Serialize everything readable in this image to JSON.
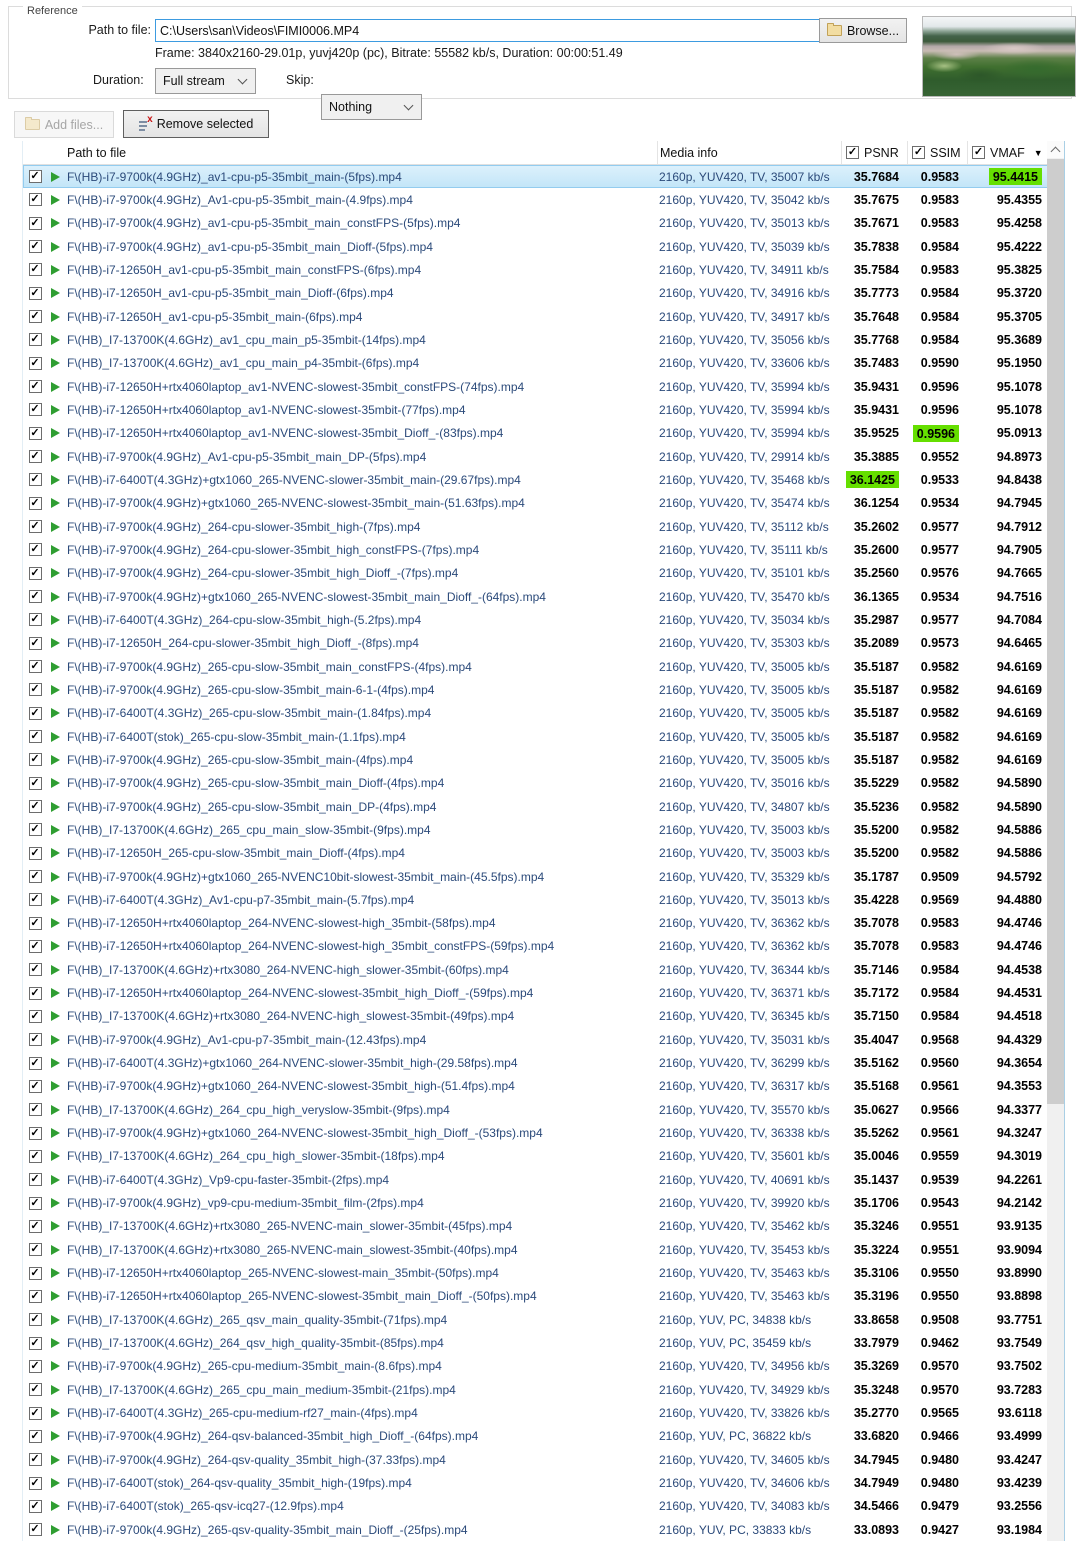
{
  "reference": {
    "group_label": "Reference",
    "path_label": "Path to file:",
    "path_value": "C:\\Users\\san\\Videos\\FIMI0006.MP4",
    "browse_label": "Browse...",
    "frame_info": "Frame: 3840x2160-29.01p, yuvj420p (pc), Bitrate: 55582 kb/s, Duration: 00:00:51.49",
    "duration_label": "Duration:",
    "duration_value": "Full stream",
    "skip_label": "Skip:",
    "skip_value": "Nothing"
  },
  "toolbar": {
    "add_files_label": "Add files...",
    "remove_selected_label": "Remove selected"
  },
  "table": {
    "columns": {
      "path": "Path to file",
      "media": "Media info",
      "psnr": "PSNR",
      "ssim": "SSIM",
      "vmaf": "VMAF"
    },
    "column_checkboxes": {
      "psnr": true,
      "ssim": true,
      "vmaf": true
    },
    "sort_column": "VMAF",
    "sort_direction": "desc",
    "rows": [
      {
        "file": "F\\(HB)-i7-9700k(4.9GHz)_av1-cpu-p5-35mbit_main-(5fps).mp4",
        "media": "2160p, YUV420, TV, 35007 kb/s",
        "psnr": "35.7684",
        "ssim": "0.9583",
        "vmaf": "95.4415",
        "hl": "vmaf",
        "selected": true
      },
      {
        "file": "F\\(HB)-i7-9700k(4.9GHz)_Av1-cpu-p5-35mbit_main-(4.9fps).mp4",
        "media": "2160p, YUV420, TV, 35042 kb/s",
        "psnr": "35.7675",
        "ssim": "0.9583",
        "vmaf": "95.4355"
      },
      {
        "file": "F\\(HB)-i7-9700k(4.9GHz)_av1-cpu-p5-35mbit_main_constFPS-(5fps).mp4",
        "media": "2160p, YUV420, TV, 35013 kb/s",
        "psnr": "35.7671",
        "ssim": "0.9583",
        "vmaf": "95.4258"
      },
      {
        "file": "F\\(HB)-i7-9700k(4.9GHz)_av1-cpu-p5-35mbit_main_Dioff-(5fps).mp4",
        "media": "2160p, YUV420, TV, 35039 kb/s",
        "psnr": "35.7838",
        "ssim": "0.9584",
        "vmaf": "95.4222"
      },
      {
        "file": "F\\(HB)-i7-12650H_av1-cpu-p5-35mbit_main_constFPS-(6fps).mp4",
        "media": "2160p, YUV420, TV, 34911 kb/s",
        "psnr": "35.7584",
        "ssim": "0.9583",
        "vmaf": "95.3825"
      },
      {
        "file": "F\\(HB)-i7-12650H_av1-cpu-p5-35mbit_main_Dioff-(6fps).mp4",
        "media": "2160p, YUV420, TV, 34916 kb/s",
        "psnr": "35.7773",
        "ssim": "0.9584",
        "vmaf": "95.3720"
      },
      {
        "file": "F\\(HB)-i7-12650H_av1-cpu-p5-35mbit_main-(6fps).mp4",
        "media": "2160p, YUV420, TV, 34917 kb/s",
        "psnr": "35.7648",
        "ssim": "0.9584",
        "vmaf": "95.3705"
      },
      {
        "file": "F\\(HB)_I7-13700K(4.6GHz)_av1_cpu_main_p5-35mbit-(14fps).mp4",
        "media": "2160p, YUV420, TV, 35056 kb/s",
        "psnr": "35.7768",
        "ssim": "0.9584",
        "vmaf": "95.3689"
      },
      {
        "file": "F\\(HB)_I7-13700K(4.6GHz)_av1_cpu_main_p4-35mbit-(6fps).mp4",
        "media": "2160p, YUV420, TV, 33606 kb/s",
        "psnr": "35.7483",
        "ssim": "0.9590",
        "vmaf": "95.1950"
      },
      {
        "file": "F\\(HB)-i7-12650H+rtx4060laptop_av1-NVENC-slowest-35mbit_constFPS-(74fps).mp4",
        "media": "2160p, YUV420, TV, 35994 kb/s",
        "psnr": "35.9431",
        "ssim": "0.9596",
        "vmaf": "95.1078"
      },
      {
        "file": "F\\(HB)-i7-12650H+rtx4060laptop_av1-NVENC-slowest-35mbit-(77fps).mp4",
        "media": "2160p, YUV420, TV, 35994 kb/s",
        "psnr": "35.9431",
        "ssim": "0.9596",
        "vmaf": "95.1078"
      },
      {
        "file": "F\\(HB)-i7-12650H+rtx4060laptop_av1-NVENC-slowest-35mbit_Dioff_-(83fps).mp4",
        "media": "2160p, YUV420, TV, 35994 kb/s",
        "psnr": "35.9525",
        "ssim": "0.9596",
        "vmaf": "95.0913",
        "hl": "ssim"
      },
      {
        "file": "F\\(HB)-i7-9700k(4.9GHz)_Av1-cpu-p5-35mbit_main_DP-(5fps).mp4",
        "media": "2160p, YUV420, TV, 29914 kb/s",
        "psnr": "35.3885",
        "ssim": "0.9552",
        "vmaf": "94.8973"
      },
      {
        "file": "F\\(HB)-i7-6400T(4.3GHz)+gtx1060_265-NVENC-slower-35mbit_main-(29.67fps).mp4",
        "media": "2160p, YUV420, TV, 35468 kb/s",
        "psnr": "36.1425",
        "ssim": "0.9533",
        "vmaf": "94.8438",
        "hl": "psnr"
      },
      {
        "file": "F\\(HB)-i7-9700k(4.9GHz)+gtx1060_265-NVENC-slowest-35mbit_main-(51.63fps).mp4",
        "media": "2160p, YUV420, TV, 35474 kb/s",
        "psnr": "36.1254",
        "ssim": "0.9534",
        "vmaf": "94.7945"
      },
      {
        "file": "F\\(HB)-i7-9700k(4.9GHz)_264-cpu-slower-35mbit_high-(7fps).mp4",
        "media": "2160p, YUV420, TV, 35112 kb/s",
        "psnr": "35.2602",
        "ssim": "0.9577",
        "vmaf": "94.7912"
      },
      {
        "file": "F\\(HB)-i7-9700k(4.9GHz)_264-cpu-slower-35mbit_high_constFPS-(7fps).mp4",
        "media": "2160p, YUV420, TV, 35111 kb/s",
        "psnr": "35.2600",
        "ssim": "0.9577",
        "vmaf": "94.7905"
      },
      {
        "file": "F\\(HB)-i7-9700k(4.9GHz)_264-cpu-slower-35mbit_high_Dioff_-(7fps).mp4",
        "media": "2160p, YUV420, TV, 35101 kb/s",
        "psnr": "35.2560",
        "ssim": "0.9576",
        "vmaf": "94.7665"
      },
      {
        "file": "F\\(HB)-i7-9700k(4.9GHz)+gtx1060_265-NVENC-slowest-35mbit_main_Dioff_-(64fps).mp4",
        "media": "2160p, YUV420, TV, 35470 kb/s",
        "psnr": "36.1365",
        "ssim": "0.9534",
        "vmaf": "94.7516"
      },
      {
        "file": "F\\(HB)-i7-6400T(4.3GHz)_264-cpu-slow-35mbit_high-(5.2fps).mp4",
        "media": "2160p, YUV420, TV, 35034 kb/s",
        "psnr": "35.2987",
        "ssim": "0.9577",
        "vmaf": "94.7084"
      },
      {
        "file": "F\\(HB)-i7-12650H_264-cpu-slower-35mbit_high_Dioff_-(8fps).mp4",
        "media": "2160p, YUV420, TV, 35303 kb/s",
        "psnr": "35.2089",
        "ssim": "0.9573",
        "vmaf": "94.6465"
      },
      {
        "file": "F\\(HB)-i7-9700k(4.9GHz)_265-cpu-slow-35mbit_main_constFPS-(4fps).mp4",
        "media": "2160p, YUV420, TV, 35005 kb/s",
        "psnr": "35.5187",
        "ssim": "0.9582",
        "vmaf": "94.6169"
      },
      {
        "file": "F\\(HB)-i7-9700k(4.9GHz)_265-cpu-slow-35mbit_main-6-1-(4fps).mp4",
        "media": "2160p, YUV420, TV, 35005 kb/s",
        "psnr": "35.5187",
        "ssim": "0.9582",
        "vmaf": "94.6169"
      },
      {
        "file": "F\\(HB)-i7-6400T(4.3GHz)_265-cpu-slow-35mbit_main-(1.84fps).mp4",
        "media": "2160p, YUV420, TV, 35005 kb/s",
        "psnr": "35.5187",
        "ssim": "0.9582",
        "vmaf": "94.6169"
      },
      {
        "file": "F\\(HB)-i7-6400T(stok)_265-cpu-slow-35mbit_main-(1.1fps).mp4",
        "media": "2160p, YUV420, TV, 35005 kb/s",
        "psnr": "35.5187",
        "ssim": "0.9582",
        "vmaf": "94.6169"
      },
      {
        "file": "F\\(HB)-i7-9700k(4.9GHz)_265-cpu-slow-35mbit_main-(4fps).mp4",
        "media": "2160p, YUV420, TV, 35005 kb/s",
        "psnr": "35.5187",
        "ssim": "0.9582",
        "vmaf": "94.6169"
      },
      {
        "file": "F\\(HB)-i7-9700k(4.9GHz)_265-cpu-slow-35mbit_main_Dioff-(4fps).mp4",
        "media": "2160p, YUV420, TV, 35016 kb/s",
        "psnr": "35.5229",
        "ssim": "0.9582",
        "vmaf": "94.5890"
      },
      {
        "file": "F\\(HB)-i7-9700k(4.9GHz)_265-cpu-slow-35mbit_main_DP-(4fps).mp4",
        "media": "2160p, YUV420, TV, 34807 kb/s",
        "psnr": "35.5236",
        "ssim": "0.9582",
        "vmaf": "94.5890"
      },
      {
        "file": "F\\(HB)_I7-13700K(4.6GHz)_265_cpu_main_slow-35mbit-(9fps).mp4",
        "media": "2160p, YUV420, TV, 35003 kb/s",
        "psnr": "35.5200",
        "ssim": "0.9582",
        "vmaf": "94.5886"
      },
      {
        "file": "F\\(HB)-i7-12650H_265-cpu-slow-35mbit_main_Dioff-(4fps).mp4",
        "media": "2160p, YUV420, TV, 35003 kb/s",
        "psnr": "35.5200",
        "ssim": "0.9582",
        "vmaf": "94.5886"
      },
      {
        "file": "F\\(HB)-i7-9700k(4.9GHz)+gtx1060_265-NVENC10bit-slowest-35mbit_main-(45.5fps).mp4",
        "media": "2160p, YUV420, TV, 35329 kb/s",
        "psnr": "35.1787",
        "ssim": "0.9509",
        "vmaf": "94.5792"
      },
      {
        "file": "F\\(HB)-i7-6400T(4.3GHz)_Av1-cpu-p7-35mbit_main-(5.7fps).mp4",
        "media": "2160p, YUV420, TV, 35013 kb/s",
        "psnr": "35.4228",
        "ssim": "0.9569",
        "vmaf": "94.4880"
      },
      {
        "file": "F\\(HB)-i7-12650H+rtx4060laptop_264-NVENC-slowest-high_35mbit-(58fps).mp4",
        "media": "2160p, YUV420, TV, 36362 kb/s",
        "psnr": "35.7078",
        "ssim": "0.9583",
        "vmaf": "94.4746"
      },
      {
        "file": "F\\(HB)-i7-12650H+rtx4060laptop_264-NVENC-slowest-high_35mbit_constFPS-(59fps).mp4",
        "media": "2160p, YUV420, TV, 36362 kb/s",
        "psnr": "35.7078",
        "ssim": "0.9583",
        "vmaf": "94.4746"
      },
      {
        "file": "F\\(HB)_I7-13700K(4.6GHz)+rtx3080_264-NVENC-high_slower-35mbit-(60fps).mp4",
        "media": "2160p, YUV420, TV, 36344 kb/s",
        "psnr": "35.7146",
        "ssim": "0.9584",
        "vmaf": "94.4538"
      },
      {
        "file": "F\\(HB)-i7-12650H+rtx4060laptop_264-NVENC-slowest-35mbit_high_Dioff_-(59fps).mp4",
        "media": "2160p, YUV420, TV, 36371 kb/s",
        "psnr": "35.7172",
        "ssim": "0.9584",
        "vmaf": "94.4531"
      },
      {
        "file": "F\\(HB)_I7-13700K(4.6GHz)+rtx3080_264-NVENC-high_slowest-35mbit-(49fps).mp4",
        "media": "2160p, YUV420, TV, 36345 kb/s",
        "psnr": "35.7150",
        "ssim": "0.9584",
        "vmaf": "94.4518"
      },
      {
        "file": "F\\(HB)-i7-9700k(4.9GHz)_Av1-cpu-p7-35mbit_main-(12.43fps).mp4",
        "media": "2160p, YUV420, TV, 35031 kb/s",
        "psnr": "35.4047",
        "ssim": "0.9568",
        "vmaf": "94.4329"
      },
      {
        "file": "F\\(HB)-i7-6400T(4.3GHz)+gtx1060_264-NVENC-slower-35mbit_high-(29.58fps).mp4",
        "media": "2160p, YUV420, TV, 36299 kb/s",
        "psnr": "35.5162",
        "ssim": "0.9560",
        "vmaf": "94.3654"
      },
      {
        "file": "F\\(HB)-i7-9700k(4.9GHz)+gtx1060_264-NVENC-slowest-35mbit_high-(51.4fps).mp4",
        "media": "2160p, YUV420, TV, 36317 kb/s",
        "psnr": "35.5168",
        "ssim": "0.9561",
        "vmaf": "94.3553"
      },
      {
        "file": "F\\(HB)_I7-13700K(4.6GHz)_264_cpu_high_veryslow-35mbit-(9fps).mp4",
        "media": "2160p, YUV420, TV, 35570 kb/s",
        "psnr": "35.0627",
        "ssim": "0.9566",
        "vmaf": "94.3377"
      },
      {
        "file": "F\\(HB)-i7-9700k(4.9GHz)+gtx1060_264-NVENC-slowest-35mbit_high_Dioff_-(53fps).mp4",
        "media": "2160p, YUV420, TV, 36338 kb/s",
        "psnr": "35.5262",
        "ssim": "0.9561",
        "vmaf": "94.3247"
      },
      {
        "file": "F\\(HB)_I7-13700K(4.6GHz)_264_cpu_high_slower-35mbit-(18fps).mp4",
        "media": "2160p, YUV420, TV, 35601 kb/s",
        "psnr": "35.0046",
        "ssim": "0.9559",
        "vmaf": "94.3019"
      },
      {
        "file": "F\\(HB)-i7-6400T(4.3GHz)_Vp9-cpu-faster-35mbit-(2fps).mp4",
        "media": "2160p, YUV420, TV, 40691 kb/s",
        "psnr": "35.1437",
        "ssim": "0.9539",
        "vmaf": "94.2261"
      },
      {
        "file": "F\\(HB)-i7-9700k(4.9GHz)_vp9-cpu-medium-35mbit_film-(2fps).mp4",
        "media": "2160p, YUV420, TV, 39920 kb/s",
        "psnr": "35.1706",
        "ssim": "0.9543",
        "vmaf": "94.2142"
      },
      {
        "file": "F\\(HB)_I7-13700K(4.6GHz)+rtx3080_265-NVENC-main_slower-35mbit-(45fps).mp4",
        "media": "2160p, YUV420, TV, 35462 kb/s",
        "psnr": "35.3246",
        "ssim": "0.9551",
        "vmaf": "93.9135"
      },
      {
        "file": "F\\(HB)_I7-13700K(4.6GHz)+rtx3080_265-NVENC-main_slowest-35mbit-(40fps).mp4",
        "media": "2160p, YUV420, TV, 35453 kb/s",
        "psnr": "35.3224",
        "ssim": "0.9551",
        "vmaf": "93.9094"
      },
      {
        "file": "F\\(HB)-i7-12650H+rtx4060laptop_265-NVENC-slowest-main_35mbit-(50fps).mp4",
        "media": "2160p, YUV420, TV, 35463 kb/s",
        "psnr": "35.3106",
        "ssim": "0.9550",
        "vmaf": "93.8990"
      },
      {
        "file": "F\\(HB)-i7-12650H+rtx4060laptop_265-NVENC-slowest-35mbit_main_Dioff_-(50fps).mp4",
        "media": "2160p, YUV420, TV, 35463 kb/s",
        "psnr": "35.3196",
        "ssim": "0.9550",
        "vmaf": "93.8898"
      },
      {
        "file": "F\\(HB)_I7-13700K(4.6GHz)_265_qsv_main_quality-35mbit-(71fps).mp4",
        "media": "2160p, YUV, PC, 34838 kb/s",
        "psnr": "33.8658",
        "ssim": "0.9508",
        "vmaf": "93.7751"
      },
      {
        "file": "F\\(HB)_I7-13700K(4.6GHz)_264_qsv_high_quality-35mbit-(85fps).mp4",
        "media": "2160p, YUV, PC, 35459 kb/s",
        "psnr": "33.7979",
        "ssim": "0.9462",
        "vmaf": "93.7549"
      },
      {
        "file": "F\\(HB)-i7-9700k(4.9GHz)_265-cpu-medium-35mbit_main-(8.6fps).mp4",
        "media": "2160p, YUV420, TV, 34956 kb/s",
        "psnr": "35.3269",
        "ssim": "0.9570",
        "vmaf": "93.7502"
      },
      {
        "file": "F\\(HB)_I7-13700K(4.6GHz)_265_cpu_main_medium-35mbit-(21fps).mp4",
        "media": "2160p, YUV420, TV, 34929 kb/s",
        "psnr": "35.3248",
        "ssim": "0.9570",
        "vmaf": "93.7283"
      },
      {
        "file": "F\\(HB)-i7-6400T(4.3GHz)_265-cpu-medium-rf27_main-(4fps).mp4",
        "media": "2160p, YUV420, TV, 33826 kb/s",
        "psnr": "35.2770",
        "ssim": "0.9565",
        "vmaf": "93.6118"
      },
      {
        "file": "F\\(HB)-i7-9700k(4.9GHz)_264-qsv-balanced-35mbit_high_Dioff_-(64fps).mp4",
        "media": "2160p, YUV, PC, 36822 kb/s",
        "psnr": "33.6820",
        "ssim": "0.9466",
        "vmaf": "93.4999"
      },
      {
        "file": "F\\(HB)-i7-9700k(4.9GHz)_264-qsv-quality_35mbit_high-(37.33fps).mp4",
        "media": "2160p, YUV420, TV, 34605 kb/s",
        "psnr": "34.7945",
        "ssim": "0.9480",
        "vmaf": "93.4247"
      },
      {
        "file": "F\\(HB)-i7-6400T(stok)_264-qsv-quality_35mbit_high-(19fps).mp4",
        "media": "2160p, YUV420, TV, 34606 kb/s",
        "psnr": "34.7949",
        "ssim": "0.9480",
        "vmaf": "93.4239"
      },
      {
        "file": "F\\(HB)-i7-6400T(stok)_265-qsv-icq27-(12.9fps).mp4",
        "media": "2160p, YUV420, TV, 34083 kb/s",
        "psnr": "34.5466",
        "ssim": "0.9479",
        "vmaf": "93.2556"
      },
      {
        "file": "F\\(HB)-i7-9700k(4.9GHz)_265-qsv-quality-35mbit_main_Dioff_-(25fps).mp4",
        "media": "2160p, YUV, PC, 33833 kb/s",
        "psnr": "33.0893",
        "ssim": "0.9427",
        "vmaf": "93.1984"
      }
    ]
  },
  "colors": {
    "selection_bg": "#cfe9fa",
    "selection_border": "#93ccef",
    "highlight_green": "#65df00",
    "file_text_blue": "#2b4a7a",
    "input_focus_border": "#3d9be0",
    "play_icon_green": "#2f9e32"
  }
}
